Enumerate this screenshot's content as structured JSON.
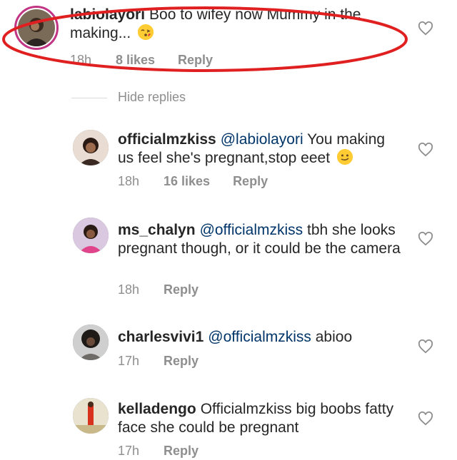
{
  "comments": [
    {
      "username": "labiolayori",
      "text": "Boo to  wifey  now Mummy in the making...",
      "emoji": "kissing-face",
      "time": "18h",
      "likes": "8 likes",
      "reply": "Reply"
    },
    {
      "username": "officialmzkiss",
      "mention": "@labiolayori",
      "text": "You making us feel she's pregnant,stop eeet",
      "emoji": "slightly-smiling-face",
      "time": "18h",
      "likes": "16 likes",
      "reply": "Reply"
    },
    {
      "username": "ms_chalyn",
      "mention": "@officialmzkiss",
      "text": "tbh she looks pregnant though, or it could be the camera",
      "time": "18h",
      "reply": "Reply"
    },
    {
      "username": "charlesvivi1",
      "mention": "@officialmzkiss",
      "text": "abioo",
      "time": "17h",
      "reply": "Reply"
    },
    {
      "username": "kelladengo",
      "text": "Officialmzkiss big boobs fatty face she could be pregnant",
      "time": "17h",
      "reply": "Reply"
    }
  ],
  "hide_replies": "Hide replies",
  "colors": {
    "text": "#262626",
    "meta": "#8e8e8e",
    "mention": "#003569",
    "annotation": "#e02020"
  }
}
